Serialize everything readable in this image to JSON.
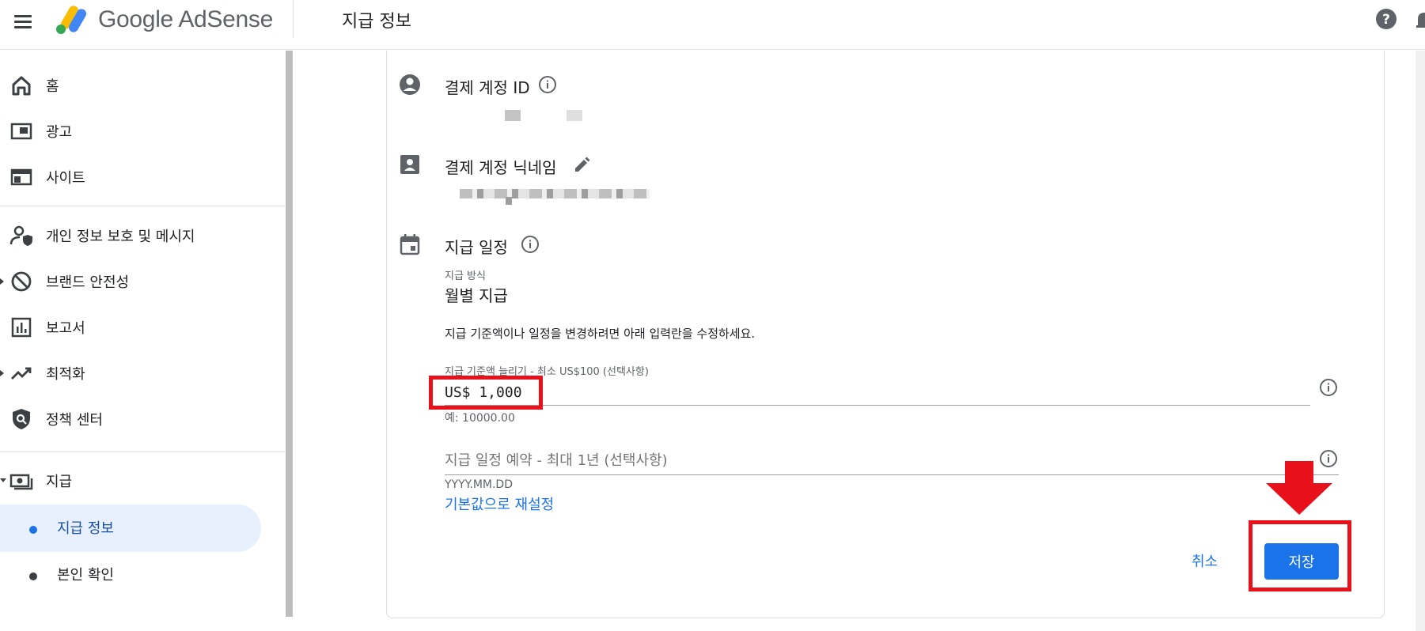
{
  "app": {
    "brand": "Google AdSense",
    "page_title": "지급 정보"
  },
  "sidebar": {
    "items": [
      {
        "label": "홈",
        "icon": "home-icon"
      },
      {
        "label": "광고",
        "icon": "ads-icon"
      },
      {
        "label": "사이트",
        "icon": "sites-icon"
      },
      {
        "label": "개인 정보 보호 및 메시지",
        "icon": "privacy-icon"
      },
      {
        "label": "브랜드 안전성",
        "icon": "block-icon"
      },
      {
        "label": "보고서",
        "icon": "reports-icon"
      },
      {
        "label": "최적화",
        "icon": "trending-icon"
      },
      {
        "label": "정책 센터",
        "icon": "policy-icon"
      },
      {
        "label": "지급",
        "icon": "payments-icon"
      }
    ],
    "sub_items": [
      {
        "label": "지급 정보",
        "active": true
      },
      {
        "label": "본인 확인",
        "active": false
      }
    ]
  },
  "payment": {
    "account_id": {
      "title": "결제 계정 ID"
    },
    "nickname": {
      "title": "결제 계정 닉네임"
    },
    "schedule": {
      "title": "지급 일정",
      "method_label": "지급 방식",
      "method_value": "월별 지급",
      "description": "지급 기준액이나 일정을 변경하려면 아래 입력란을 수정하세요.",
      "threshold_label": "지급 기준액 늘리기 - 최소 US$100 (선택사항)",
      "threshold_value": "US$ 1,000",
      "threshold_hint": "예: 10000.00",
      "date_placeholder": "지급 일정 예약 - 최대 1년 (선택사항)",
      "date_hint": "YYYY.MM.DD",
      "reset_link": "기본값으로 재설정"
    }
  },
  "actions": {
    "cancel_label": "취소",
    "save_label": "저장"
  },
  "colors": {
    "accent": "#1a73e8",
    "highlight": "#e8101a"
  }
}
